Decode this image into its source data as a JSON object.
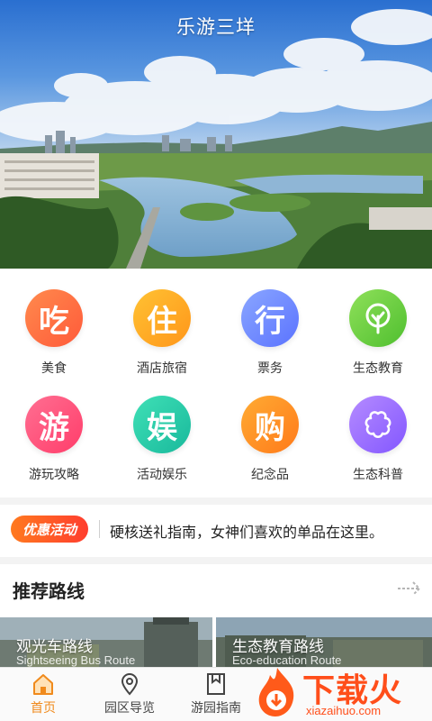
{
  "header": {
    "title": "乐游三垟"
  },
  "grid": {
    "items": [
      {
        "glyph": "吃",
        "label": "美食",
        "icon": "eat-icon",
        "color": "#ff6b3d"
      },
      {
        "glyph": "住",
        "label": "酒店旅宿",
        "icon": "stay-icon",
        "color": "#ffa31a"
      },
      {
        "glyph": "行",
        "label": "票务",
        "icon": "travel-icon",
        "color": "#6f8cff"
      },
      {
        "glyph": "",
        "label": "生态教育",
        "icon": "tree-icon",
        "color": "#6fcf3f"
      },
      {
        "glyph": "游",
        "label": "游玩攻略",
        "icon": "play-icon",
        "color": "#ff4f7a"
      },
      {
        "glyph": "娱",
        "label": "活动娱乐",
        "icon": "entertainment-icon",
        "color": "#25c9a8"
      },
      {
        "glyph": "购",
        "label": "纪念品",
        "icon": "shopping-icon",
        "color": "#ff8c1a"
      },
      {
        "glyph": "",
        "label": "生态科普",
        "icon": "flower-icon",
        "color": "#9b6bff"
      }
    ]
  },
  "promo": {
    "badge": "优惠活动",
    "text": "硬核送礼指南，女神们喜欢的单品在这里。"
  },
  "routes": {
    "title": "推荐路线",
    "cards": [
      {
        "title": "观光车路线",
        "subtitle": "Sightseeing Bus Route"
      },
      {
        "title": "生态教育路线",
        "subtitle": "Eco-education Route"
      }
    ]
  },
  "tabbar": {
    "tabs": [
      {
        "label": "首页",
        "icon": "home-icon",
        "active": true
      },
      {
        "label": "园区导览",
        "icon": "location-pin-icon",
        "active": false
      },
      {
        "label": "游园指南",
        "icon": "bookmark-icon",
        "active": false
      }
    ]
  },
  "watermark": {
    "text": "下载火",
    "url": "xiazaihuo.com"
  }
}
